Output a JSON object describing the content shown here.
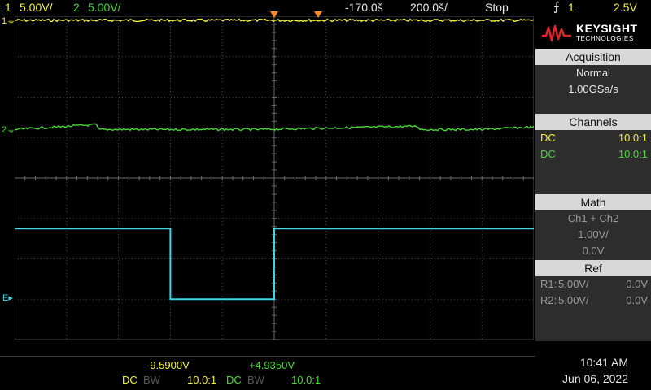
{
  "topbar": {
    "ch1_num": "1",
    "ch1_scale": "5.00V/",
    "ch2_num": "2",
    "ch2_scale": "5.00V/",
    "delay": "-170.0š",
    "timebase": "200.0š/",
    "run_state": "Stop",
    "trigger_icon": "trigger-edge-icon",
    "trigger_source": "1",
    "trigger_level": "2.5V"
  },
  "colors": {
    "ch1": "#f2ee3a",
    "ch2": "#4bd63a",
    "math": "#3ed6e6",
    "grid": "#4a4a4a",
    "marker": "#ff8a2a"
  },
  "markers": {
    "ch1_label": "1",
    "ch2_label": "2",
    "math_label": "E"
  },
  "waveforms": {
    "ch1_level_div": 3.9,
    "ch2_level_div": 1.2,
    "math_high_div": -1.25,
    "math_low_div": -3.0,
    "math_low_start_div": 1.0,
    "math_low_end_div": 3.0
  },
  "panel": {
    "brand": "KEYSIGHT",
    "brand_sub": "TECHNOLOGIES",
    "acquisition": {
      "header": "Acquisition",
      "mode": "Normal",
      "rate": "1.00GSa/s"
    },
    "channels": {
      "header": "Channels",
      "rows": [
        {
          "coupling": "DC",
          "probe": "10.0:1"
        },
        {
          "coupling": "DC",
          "probe": "10.0:1"
        }
      ]
    },
    "math": {
      "header": "Math",
      "expr": "Ch1 + Ch2",
      "scale": "1.00V/",
      "offset": "0.0V"
    },
    "ref": {
      "header": "Ref",
      "rows": [
        {
          "name": "R1:",
          "scale": "5.00V/",
          "offset": "0.0V"
        },
        {
          "name": "R2:",
          "scale": "5.00V/",
          "offset": "0.0V"
        }
      ]
    }
  },
  "bottom": {
    "ch1_offset": "-9.5900V",
    "ch2_offset": "+4.9350V",
    "ch1_coupling": "DC",
    "ch1_bw": "BW",
    "ch1_probe": "10.0:1",
    "ch2_coupling": "DC",
    "ch2_bw": "BW",
    "ch2_probe": "10.0:1",
    "time": "10:41 AM",
    "date": "Jun 06, 2022"
  }
}
